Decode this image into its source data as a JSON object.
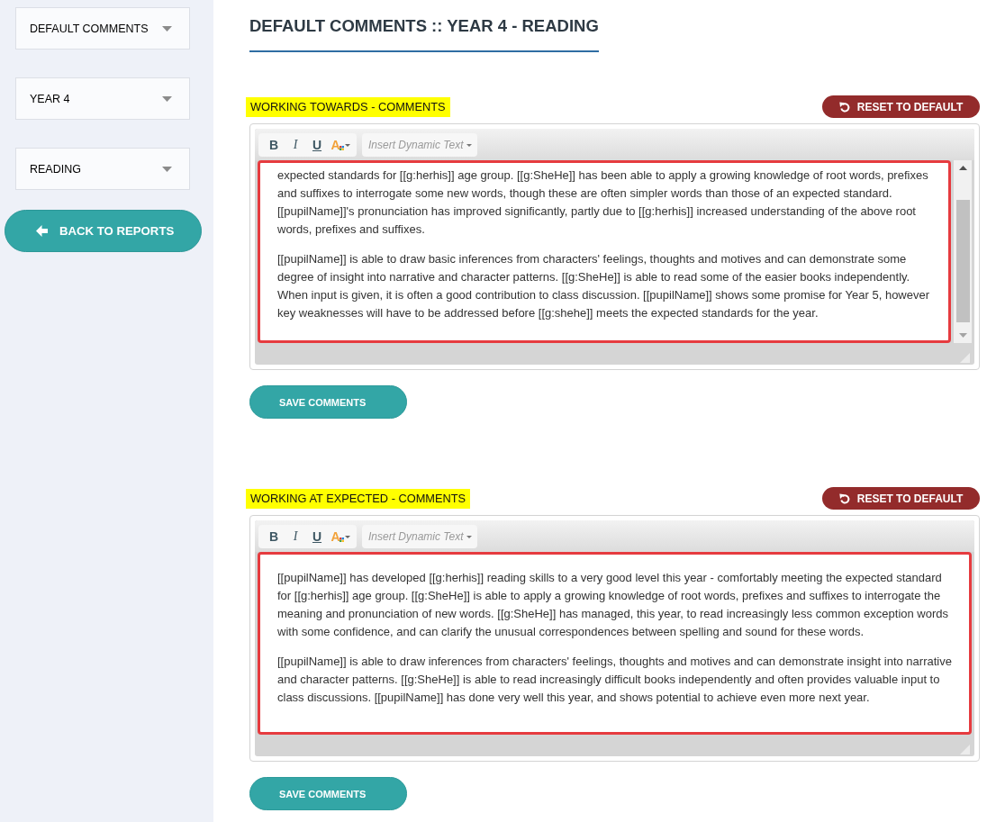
{
  "sidebar": {
    "dropdowns": [
      {
        "label": "DEFAULT COMMENTS"
      },
      {
        "label": "YEAR 4"
      },
      {
        "label": "READING"
      }
    ],
    "back_button": {
      "label": "BACK TO REPORTS"
    }
  },
  "page_title": "DEFAULT COMMENTS :: YEAR 4 - READING",
  "sections": [
    {
      "heading": "WORKING TOWARDS - COMMENTS",
      "reset_button": "RESET TO DEFAULT",
      "editor": {
        "toolbar": [
          {
            "kind": "bold",
            "label": "B"
          },
          {
            "kind": "italic",
            "label": "I"
          },
          {
            "kind": "underline",
            "label": "U"
          },
          {
            "kind": "color",
            "label": "A"
          }
        ],
        "insert_menu": {
          "label": "Insert Dynamic Text"
        },
        "scrollbar": true,
        "paragraphs": [
          "expected standards for [[g:herhis]] age group. [[g:SheHe]] has been able to apply a growing knowledge of root words, prefixes and suffixes to interrogate some new words, though these are often simpler words than those of an expected standard. [[pupilName]]'s pronunciation has improved significantly, partly due to [[g:herhis]] increased understanding of the above root words, prefixes and suffixes.",
          "[[pupilName]] is able to draw basic inferences from characters' feelings, thoughts and motives and can demonstrate some degree of insight into narrative and character patterns. [[g:SheHe]] is able to read some of the easier books independently. When input is given, it is often a good contribution to class discussion. [[pupilName]] shows some promise for Year 5, however key weaknesses will have to be addressed before [[g:shehe]] meets the expected standards for the year."
        ]
      },
      "save_button": "SAVE COMMENTS"
    },
    {
      "heading": "WORKING AT EXPECTED - COMMENTS",
      "reset_button": "RESET TO DEFAULT",
      "editor": {
        "toolbar": [
          {
            "kind": "bold",
            "label": "B"
          },
          {
            "kind": "italic",
            "label": "I"
          },
          {
            "kind": "underline",
            "label": "U"
          },
          {
            "kind": "color",
            "label": "A"
          }
        ],
        "insert_menu": {
          "label": "Insert Dynamic Text"
        },
        "scrollbar": false,
        "paragraphs": [
          "[[pupilName]] has developed [[g:herhis]] reading skills to a very good level this year - comfortably meeting the expected standard for [[g:herhis]] age group. [[g:SheHe]] is able to apply a growing knowledge of root words, prefixes and suffixes to interrogate the meaning and pronunciation of new words. [[g:SheHe]] has managed, this year, to read increasingly less common exception words with some confidence, and can clarify the unusual correspondences between spelling and sound for these words.",
          "[[pupilName]] is able to draw inferences from characters' feelings, thoughts and motives and can demonstrate insight into narrative and character patterns. [[g:SheHe]] is able to read increasingly difficult books independently and often provides valuable input to class discussions. [[pupilName]] has done very well this year, and shows potential to achieve even more next year."
        ]
      },
      "save_button": "SAVE COMMENTS"
    }
  ]
}
